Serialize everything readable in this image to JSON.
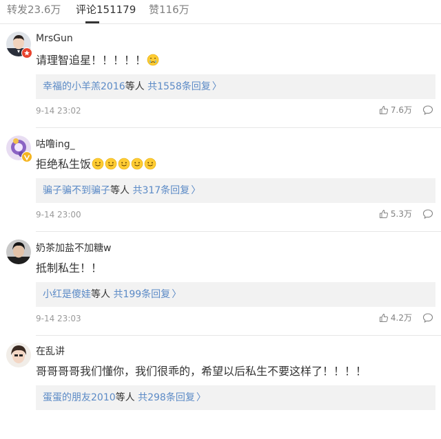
{
  "tabs": {
    "repost": "转发23.6万",
    "comment": "评论151179",
    "like": "赞116万"
  },
  "comments": [
    {
      "username": "MrsGun",
      "content": "请理智追星！！！！！",
      "reply_users": "幸福的小羊羔2016",
      "reply_suffix": "等人",
      "reply_count": "共1558条回复",
      "reply_chevron": "〉",
      "time": "9-14 23:02",
      "likes": "7.6万",
      "emoji": [
        "crying-face"
      ]
    },
    {
      "username": "咕噜ing_",
      "content": "拒绝私生饭",
      "reply_users": "骗子骗不到骗子",
      "reply_suffix": "等人",
      "reply_count": "共317条回复",
      "reply_chevron": "〉",
      "time": "9-14 23:00",
      "likes": "5.3万",
      "emoji": [
        "smile-face",
        "smile-face",
        "smile-face",
        "smile-face",
        "smile-face"
      ]
    },
    {
      "username": "奶茶加盐不加糖w",
      "content": "抵制私生！！",
      "reply_users": "小红是傻娃",
      "reply_suffix": "等人",
      "reply_count": "共199条回复",
      "reply_chevron": "〉",
      "time": "9-14 23:03",
      "likes": "4.2万",
      "emoji": []
    },
    {
      "username": "在乱讲",
      "content": "哥哥哥哥我们懂你，我们很乖的，希望以后私生不要这样了！！！！",
      "reply_users": "蛋蛋的朋友2010",
      "reply_suffix": "等人",
      "reply_count": "共298条回复",
      "reply_chevron": "〉",
      "time": "",
      "likes": "",
      "emoji": []
    }
  ],
  "icons": {
    "like": "thumbs-up-icon",
    "reply": "comment-bubble-icon",
    "verified_red": "verified-badge-red-icon",
    "verified_gold": "verified-badge-gold-icon"
  },
  "colors": {
    "link": "#5b8ac6",
    "reply_bg": "#f2f2f2",
    "badge_red": "#e8432e",
    "badge_gold": "#f5b521"
  }
}
